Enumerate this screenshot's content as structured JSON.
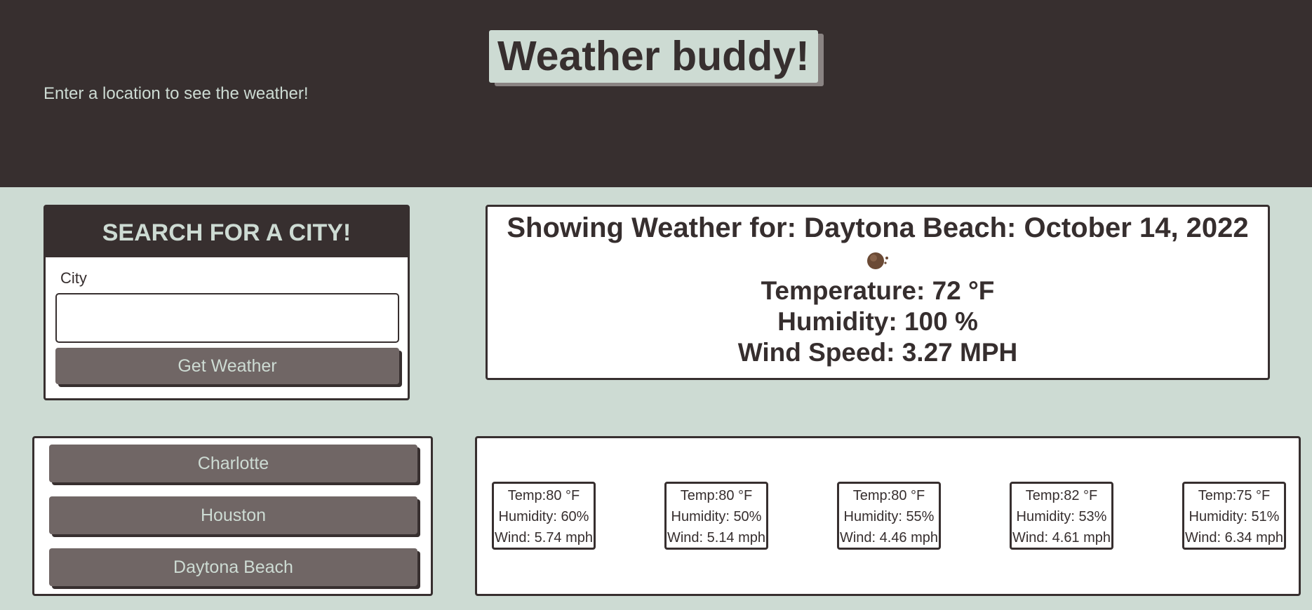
{
  "header": {
    "title": "Weather buddy!",
    "subtitle": "Enter a location to see the weather!"
  },
  "search": {
    "heading": "SEARCH FOR A CITY!",
    "city_label": "City",
    "city_value": "",
    "button_label": "Get Weather"
  },
  "current": {
    "heading": "Showing Weather for: Daytona Beach: October 14, 2022",
    "icon": "weather-icon",
    "temperature": "Temperature: 72 °F",
    "humidity": "Humidity: 100 %",
    "wind": "Wind Speed: 3.27 MPH"
  },
  "history": [
    "Charlotte",
    "Houston",
    "Daytona Beach"
  ],
  "forecast": [
    {
      "temp": "Temp:80 °F",
      "humidity": "Humidity: 60%",
      "wind": "Wind: 5.74 mph"
    },
    {
      "temp": "Temp:80 °F",
      "humidity": "Humidity: 50%",
      "wind": "Wind: 5.14 mph"
    },
    {
      "temp": "Temp:80 °F",
      "humidity": "Humidity: 55%",
      "wind": "Wind: 4.46 mph"
    },
    {
      "temp": "Temp:82 °F",
      "humidity": "Humidity: 53%",
      "wind": "Wind: 4.61 mph"
    },
    {
      "temp": "Temp:75 °F",
      "humidity": "Humidity: 51%",
      "wind": "Wind: 6.34 mph"
    }
  ],
  "colors": {
    "dark": "#372f2f",
    "mint": "#cddbd3",
    "button": "#706665"
  }
}
